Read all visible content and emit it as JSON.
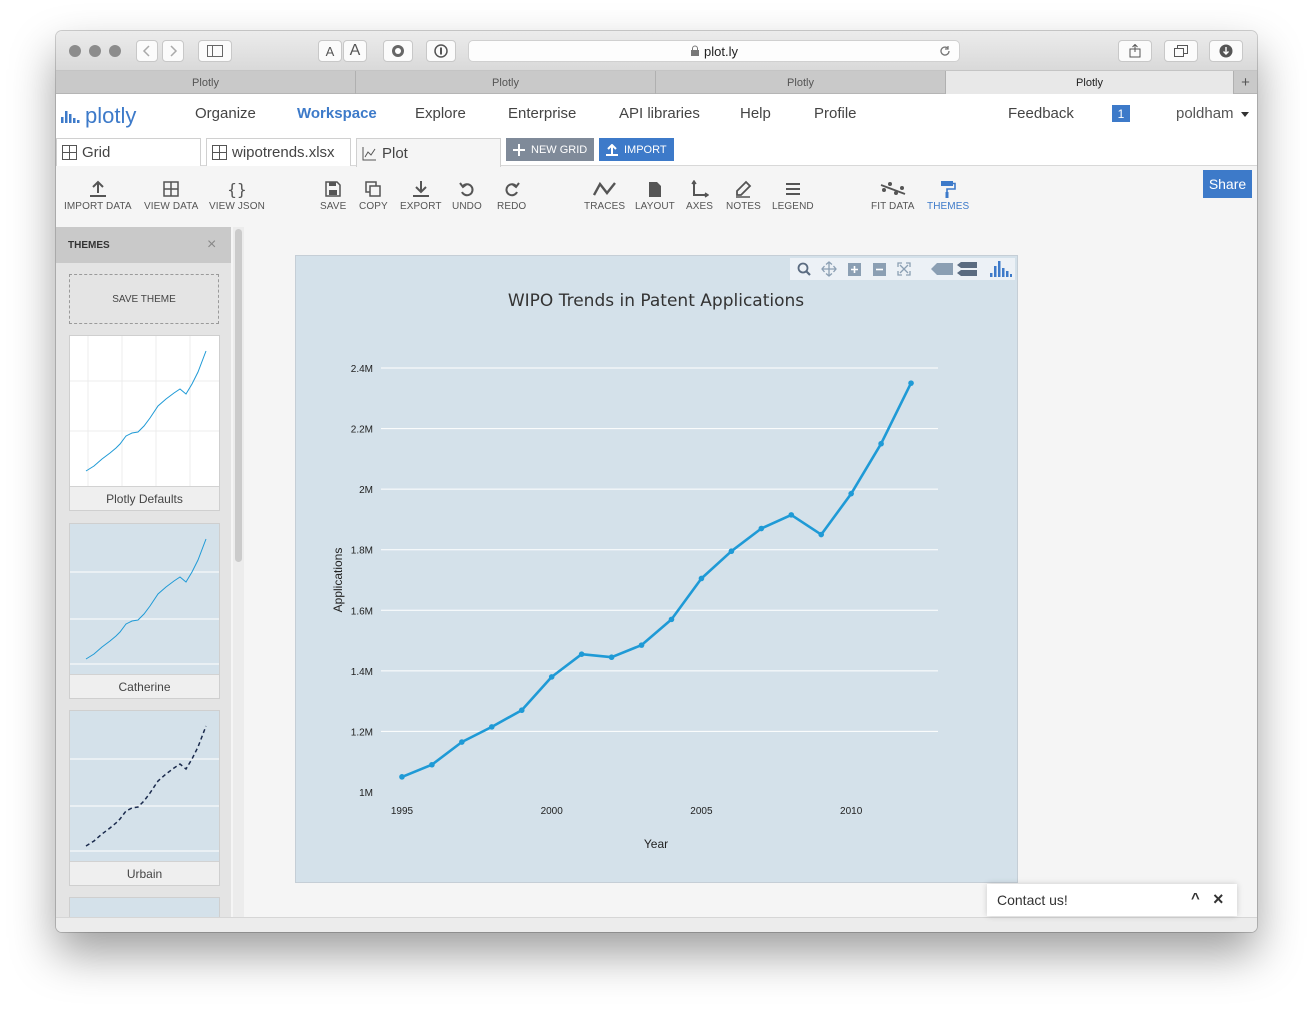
{
  "browser": {
    "address": "plot.ly",
    "text_size_small": "A",
    "text_size_large": "A",
    "tabs": [
      "Plotly",
      "Plotly",
      "Plotly",
      "Plotly"
    ],
    "new_tab": "+"
  },
  "nav": {
    "logo": "plotly",
    "links": [
      "Organize",
      "Workspace",
      "Explore",
      "Enterprise",
      "API libraries",
      "Help",
      "Profile"
    ],
    "active": "Workspace",
    "feedback": "Feedback",
    "notifications": "1",
    "user": "poldham"
  },
  "files": {
    "tabs": [
      "Grid",
      "wipotrends.xlsx",
      "Plot"
    ],
    "new_grid": "NEW GRID",
    "import": "IMPORT"
  },
  "toolbar": {
    "groups": [
      [
        "IMPORT DATA",
        "VIEW DATA",
        "VIEW JSON"
      ],
      [
        "SAVE",
        "COPY",
        "EXPORT",
        "UNDO",
        "REDO"
      ],
      [
        "TRACES",
        "LAYOUT",
        "AXES",
        "NOTES",
        "LEGEND"
      ],
      [
        "FIT DATA",
        "THEMES"
      ]
    ],
    "active": "THEMES",
    "share": "Share"
  },
  "themes_panel": {
    "title": "THEMES",
    "close": "×",
    "save_theme": "SAVE THEME",
    "themes": [
      "Plotly Defaults",
      "Catherine",
      "Urbain"
    ]
  },
  "colors": {
    "accent": "#3d7ac9",
    "trace": "#1f9ad6",
    "plot_bg": "#d4e1ea"
  },
  "chart_data": {
    "type": "line",
    "title": "WIPO Trends in Patent Applications",
    "xlabel": "Year",
    "ylabel": "Applications",
    "x": [
      1995,
      1996,
      1997,
      1998,
      1999,
      2000,
      2001,
      2002,
      2003,
      2004,
      2005,
      2006,
      2007,
      2008,
      2009,
      2010,
      2011,
      2012
    ],
    "y": [
      1050000,
      1090000,
      1165000,
      1215000,
      1270000,
      1380000,
      1455000,
      1445000,
      1485000,
      1570000,
      1705000,
      1795000,
      1870000,
      1915000,
      1850000,
      1985000,
      2150000,
      2350000
    ],
    "xlim": [
      1994.3,
      2012.9
    ],
    "ylim": [
      1000000,
      2400000
    ],
    "xticks": [
      1995,
      2000,
      2005,
      2010
    ],
    "xtick_labels": [
      "1995",
      "2000",
      "2005",
      "2010"
    ],
    "yticks": [
      1000000,
      1200000,
      1400000,
      1600000,
      1800000,
      2000000,
      2200000,
      2400000
    ],
    "ytick_labels": [
      "1M",
      "1.2M",
      "1.4M",
      "1.6M",
      "1.8M",
      "2M",
      "2.2M",
      "2.4M"
    ],
    "grid": true,
    "markers": true
  },
  "contact": {
    "label": "Contact us!",
    "collapse": "^",
    "close": "×"
  }
}
